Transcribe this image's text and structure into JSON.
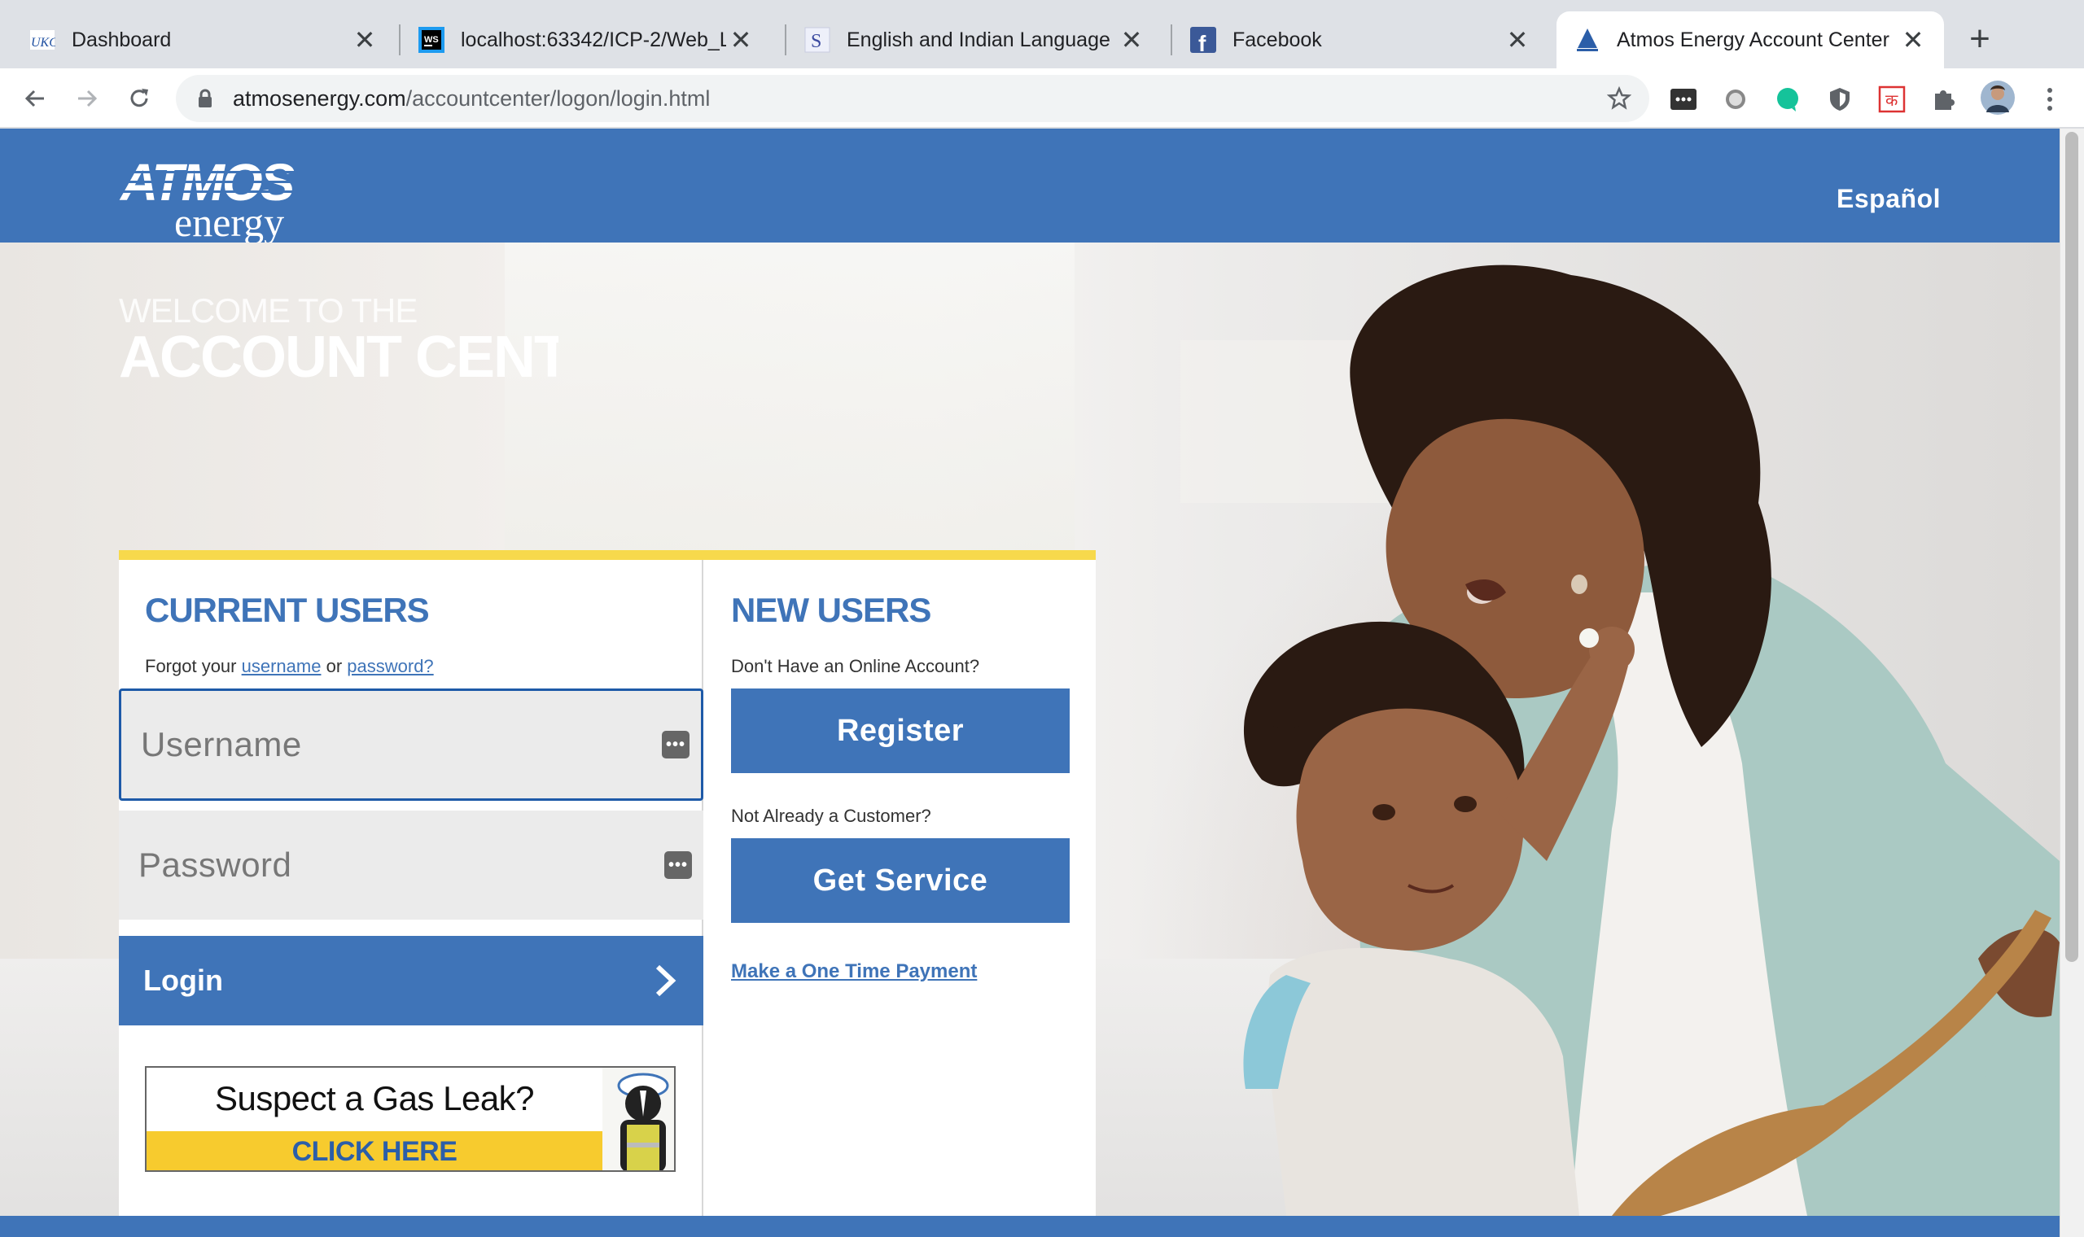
{
  "browser": {
    "tabs": [
      {
        "title": "Dashboard",
        "icon": "umkc-icon",
        "active": false
      },
      {
        "title": "localhost:63342/ICP-2/Web_L",
        "icon": "webstorm-icon",
        "active": false
      },
      {
        "title": "English and Indian Language D",
        "icon": "s-letter-icon",
        "active": false
      },
      {
        "title": "Facebook",
        "icon": "facebook-icon",
        "active": false
      },
      {
        "title": "Atmos Energy Account Center",
        "icon": "atmos-icon",
        "active": true
      }
    ],
    "url_domain": "atmosenergy.com",
    "url_path": "/accountcenter/logon/login.html"
  },
  "header": {
    "logo_top": "ATMOS",
    "logo_bottom": "energy",
    "language_link": "Español"
  },
  "hero": {
    "welcome_small": "WELCOME TO THE",
    "welcome_big": "ACCOUNT CENT"
  },
  "current_users": {
    "title": "CURRENT USERS",
    "forgot_prefix": "Forgot your",
    "forgot_username": "username",
    "forgot_or": "or",
    "forgot_password": "password?",
    "username_placeholder": "Username",
    "password_placeholder": "Password",
    "login_label": "Login",
    "gas_leak_question": "Suspect a Gas Leak?",
    "gas_leak_cta": "CLICK HERE"
  },
  "new_users": {
    "title": "NEW USERS",
    "no_account_text": "Don't Have an Online Account?",
    "register_label": "Register",
    "not_customer_text": "Not Already a Customer?",
    "get_service_label": "Get Service",
    "one_time_payment": "Make a One Time Payment"
  },
  "colors": {
    "brand_blue": "#3f74b8",
    "accent_yellow": "#f7d94c"
  }
}
